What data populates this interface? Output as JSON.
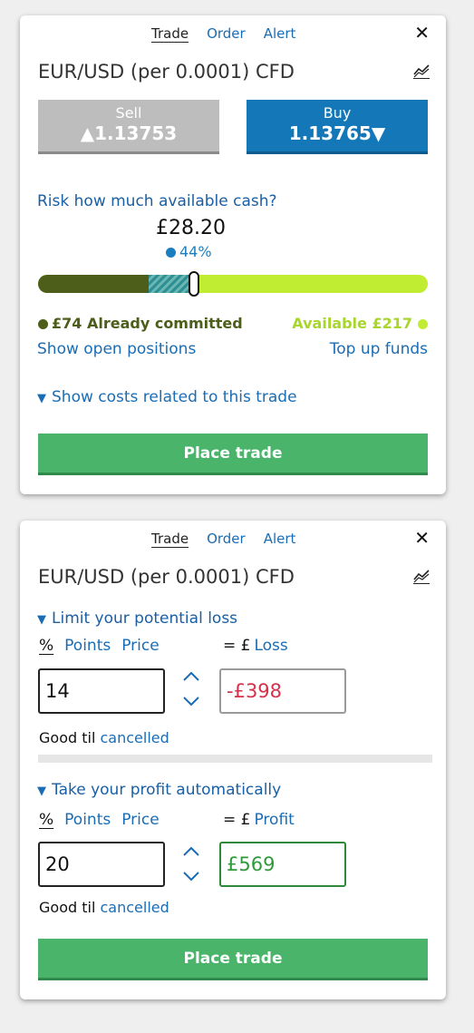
{
  "tabs": [
    "Trade",
    "Order",
    "Alert"
  ],
  "instrument": "EUR/USD (per 0.0001) CFD",
  "icons": {
    "close": "close-icon",
    "chart": "chart-icon",
    "triangle": "triangle-down-icon",
    "stepper": "chevron-up-down-icon"
  },
  "panel1": {
    "sell": {
      "label": "Sell",
      "price": "▲1.13753"
    },
    "buy": {
      "label": "Buy",
      "price": "1.13765▼"
    },
    "risk_question": "Risk how much available cash?",
    "risk_amount": "£28.20",
    "risk_percent": "44%",
    "risk_fraction": 0.44,
    "committed_label": "£74 Already committed",
    "available_label": "Available £217",
    "show_open_positions": "Show open positions",
    "top_up_funds": "Top up funds",
    "show_costs": "Show costs related to this trade",
    "place_trade": "Place trade",
    "colors": {
      "committed": "#4c5e1a",
      "available": "#c0ec32",
      "risk": "#2e8f94",
      "accent": "#1478b8"
    }
  },
  "panel2": {
    "stop": {
      "heading": "Limit your potential loss",
      "modes": [
        "%",
        "Points",
        "Price"
      ],
      "eq": "= £",
      "result_label": "Loss",
      "value": "14",
      "result": "-£398",
      "good_til": "Good til",
      "good_til_link": "cancelled"
    },
    "limit": {
      "heading": "Take your profit automatically",
      "modes": [
        "%",
        "Points",
        "Price"
      ],
      "eq": "= £",
      "result_label": "Profit",
      "value": "20",
      "result": "£569",
      "good_til": "Good til",
      "good_til_link": "cancelled"
    },
    "place_trade": "Place trade"
  }
}
